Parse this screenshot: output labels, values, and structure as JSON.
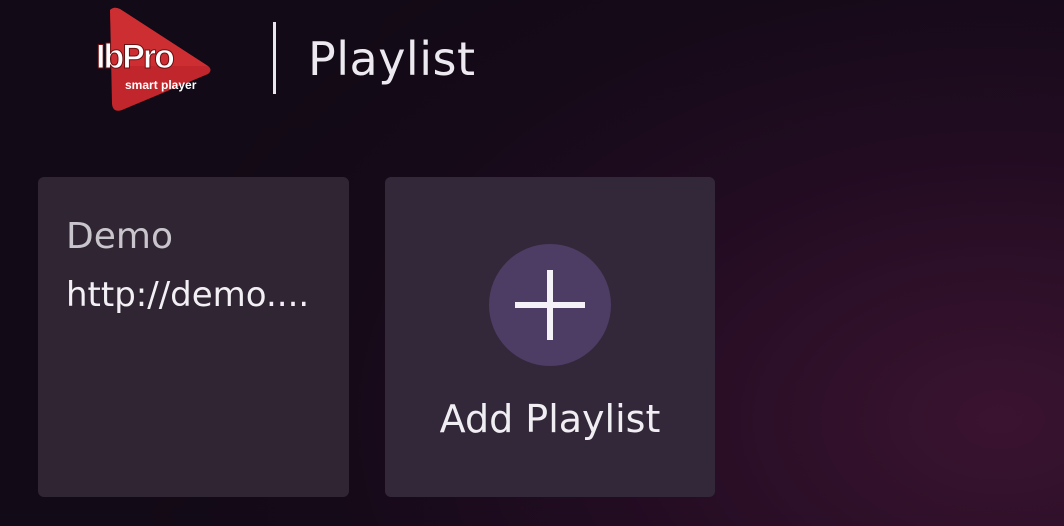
{
  "app": {
    "logo_text": "IbPro",
    "logo_subtext": "smart player",
    "logo_color": "#c0262b"
  },
  "header": {
    "title": "Playlist"
  },
  "playlists": [
    {
      "name": "Demo",
      "url": "http://demo...."
    }
  ],
  "add_card": {
    "label": "Add Playlist",
    "icon": "plus-icon",
    "circle_color": "#4d3c63"
  },
  "colors": {
    "card_background": "#302532",
    "background": "#150a18"
  }
}
